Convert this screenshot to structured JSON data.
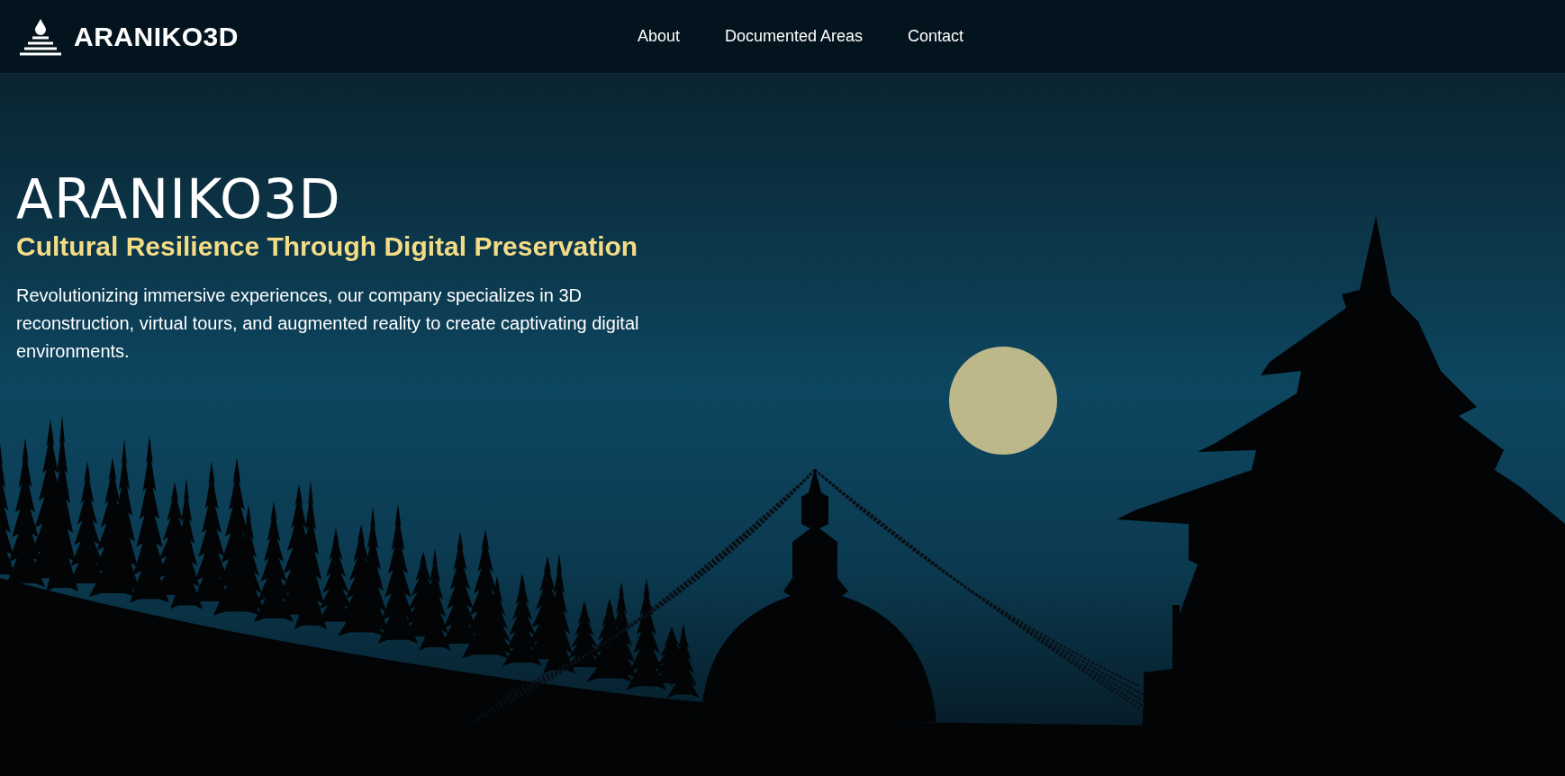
{
  "header": {
    "logo_text": "ARANIKO3D",
    "nav": [
      {
        "label": "About"
      },
      {
        "label": "Documented Areas"
      },
      {
        "label": "Contact"
      }
    ]
  },
  "hero": {
    "title": "ARANIKO3D",
    "subtitle": "Cultural Resilience Through Digital Preservation",
    "description": "Revolutionizing immersive experiences, our company specializes in 3D reconstruction, virtual tours, and augmented reality to create captivating digital environments."
  }
}
